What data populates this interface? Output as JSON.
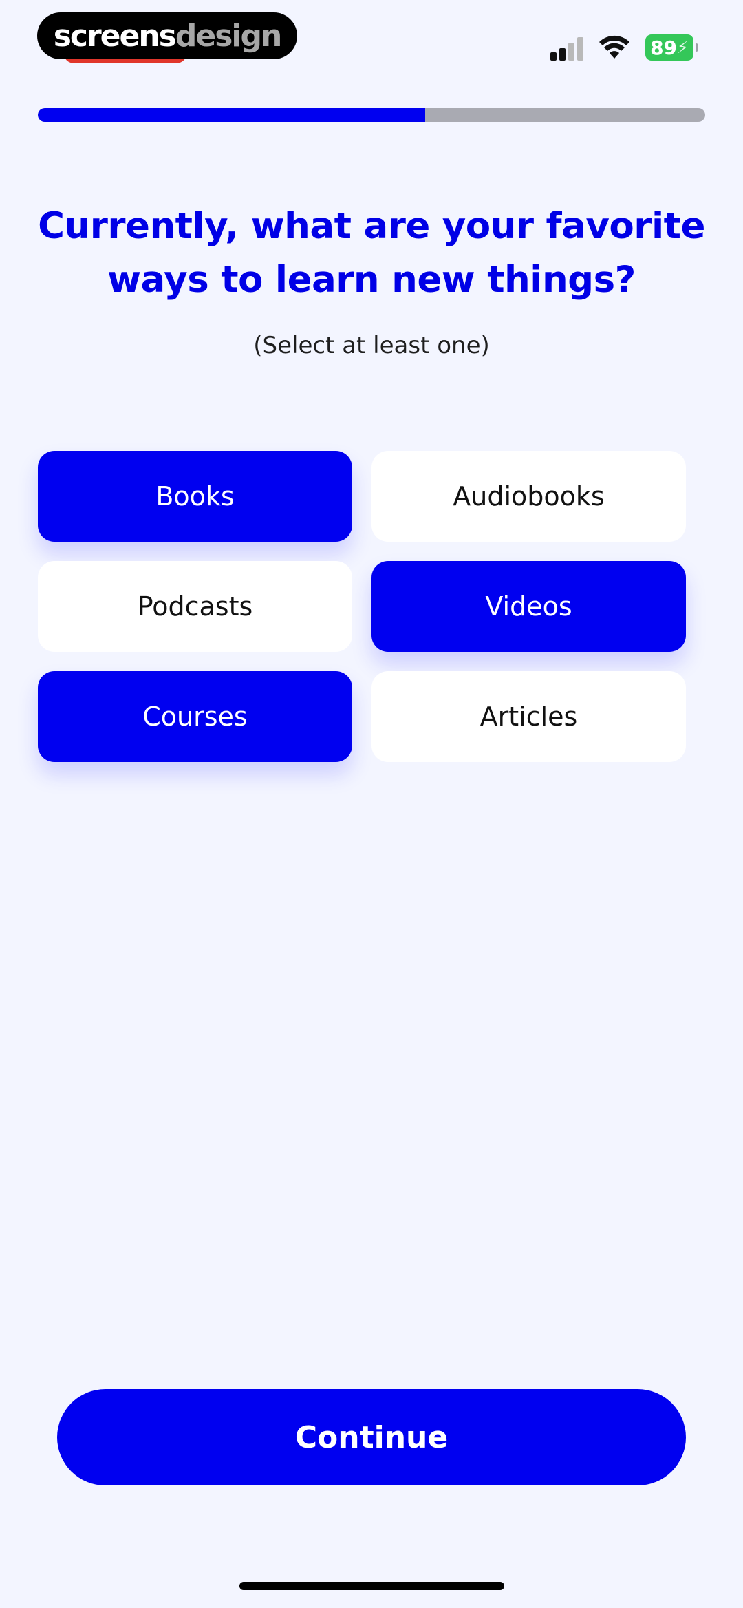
{
  "status_bar": {
    "brand_part1": "screens",
    "brand_part2": "design",
    "battery_level": "89",
    "signal_icon": "cellular-signal-icon",
    "wifi_icon": "wifi-icon",
    "battery_icon": "battery-charging-icon"
  },
  "progress": {
    "fraction": 0.58
  },
  "question": {
    "title": "Currently, what are your favorite ways to learn new things?",
    "subtitle": "(Select at least one)"
  },
  "options": [
    {
      "label": "Books",
      "selected": true
    },
    {
      "label": "Audiobooks",
      "selected": false
    },
    {
      "label": "Podcasts",
      "selected": false
    },
    {
      "label": "Videos",
      "selected": true
    },
    {
      "label": "Courses",
      "selected": true
    },
    {
      "label": "Articles",
      "selected": false
    }
  ],
  "footer": {
    "continue_label": "Continue"
  },
  "colors": {
    "accent": "#0000F0",
    "background": "#F3F5FF",
    "progress_track": "#A9AAB2",
    "battery": "#34C759"
  }
}
